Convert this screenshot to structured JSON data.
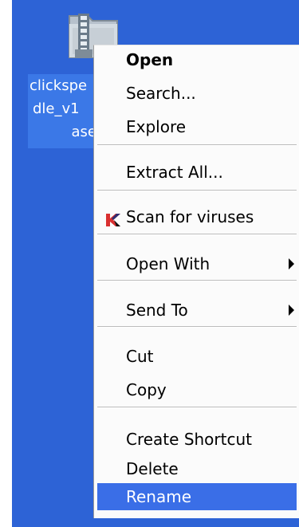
{
  "desktop": {
    "file": {
      "icon": "zip-folder-icon",
      "label_lines": [
        "clickspe",
        "dle_v1",
        "ase"
      ]
    }
  },
  "context_menu": {
    "items": [
      {
        "label": "Open",
        "bold": true
      },
      {
        "label": "Search..."
      },
      {
        "label": "Explore"
      },
      {
        "label": "Extract All..."
      },
      {
        "label": "Scan for viruses",
        "icon": "kaspersky-icon"
      },
      {
        "label": "Open With",
        "submenu": true
      },
      {
        "label": "Send To",
        "submenu": true
      },
      {
        "label": "Cut"
      },
      {
        "label": "Copy"
      },
      {
        "label": "Create Shortcut"
      },
      {
        "label": "Delete"
      },
      {
        "label": "Rename",
        "selected": true
      }
    ]
  },
  "colors": {
    "desktop_background": "#2d63d6",
    "selection": "#3a6ee7",
    "menu_background": "#fbfbfb",
    "kaspersky_red": "#d92f2f"
  }
}
